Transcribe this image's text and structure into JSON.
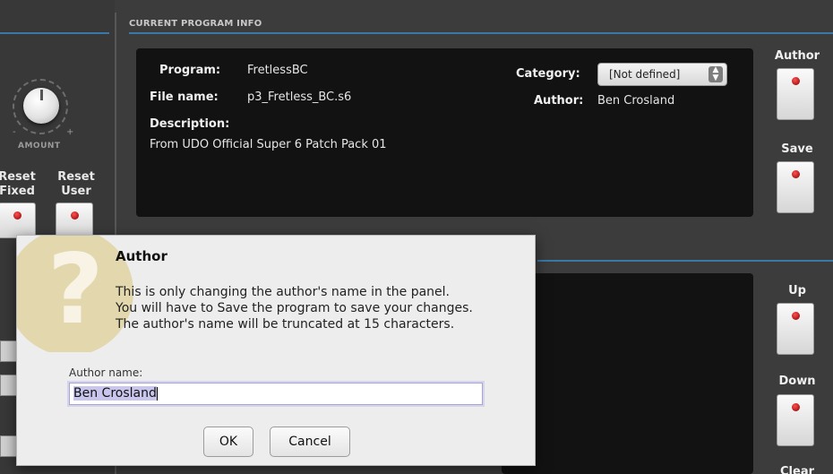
{
  "section": {
    "title": "CURRENT PROGRAM INFO"
  },
  "left_panel": {
    "amount_label": "AMOUNT",
    "knob_minus": "-",
    "knob_plus": "+",
    "reset_fixed_label": "Reset\nFixed",
    "reset_user_label": "Reset\nUser"
  },
  "program_info": {
    "program_label": "Program:",
    "program_value": "FretlessBC",
    "filename_label": "File name:",
    "filename_value": "p3_Fretless_BC.s6",
    "description_label": "Description:",
    "description_value": "From UDO Official Super 6 Patch Pack 01",
    "category_label": "Category:",
    "category_value": "[Not defined]",
    "author_label": "Author:",
    "author_value": "Ben Crosland"
  },
  "right_buttons": {
    "author": "Author",
    "save": "Save",
    "up": "Up",
    "down": "Down",
    "clear": "Clear"
  },
  "dialog": {
    "title": "Author",
    "message": "This is only changing the author's name in the panel.\nYou will have to Save the program to save your changes.\nThe author's name will be truncated at 15 characters.",
    "field_label": "Author name:",
    "field_value": "Ben Crosland",
    "ok_label": "OK",
    "cancel_label": "Cancel"
  },
  "colors": {
    "accent_line": "#3a78a8",
    "panel_bg": "#3c3c3c",
    "info_bg": "#121212",
    "led_red": "#d01818",
    "dialog_bg": "#ededed",
    "qmark_bg": "#e3d7ad"
  },
  "icons": {
    "dialog_icon": "question-mark-icon",
    "category_spinner": "up-down-spinner-icon",
    "button_led": "red-led-icon"
  }
}
